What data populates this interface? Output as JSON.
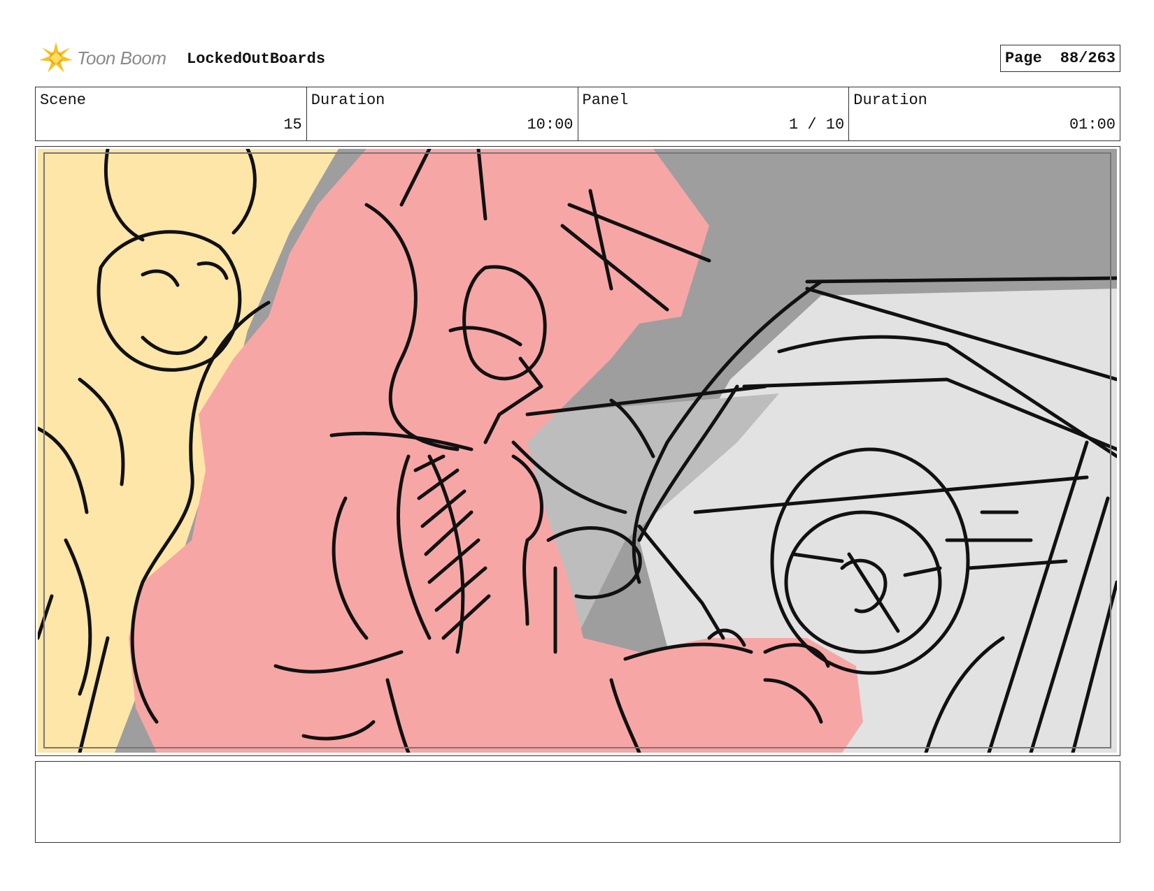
{
  "header": {
    "brand": "Toon Boom",
    "project_name": "LockedOutBoards",
    "page_label": "Page",
    "page_number": "88/263"
  },
  "info": {
    "scene_label": "Scene",
    "scene_value": "15",
    "scene_duration_label": "Duration",
    "scene_duration_value": "10:00",
    "panel_label": "Panel",
    "panel_value": "1 / 10",
    "panel_duration_label": "Duration",
    "panel_duration_value": "01:00"
  },
  "notes": {
    "text": ""
  },
  "colors": {
    "pink_character": "#f7a6a6",
    "yellow_character": "#fde6a8",
    "background_gray": "#9e9e9e",
    "light_gray": "#e2e2e2",
    "line": "#111111"
  }
}
